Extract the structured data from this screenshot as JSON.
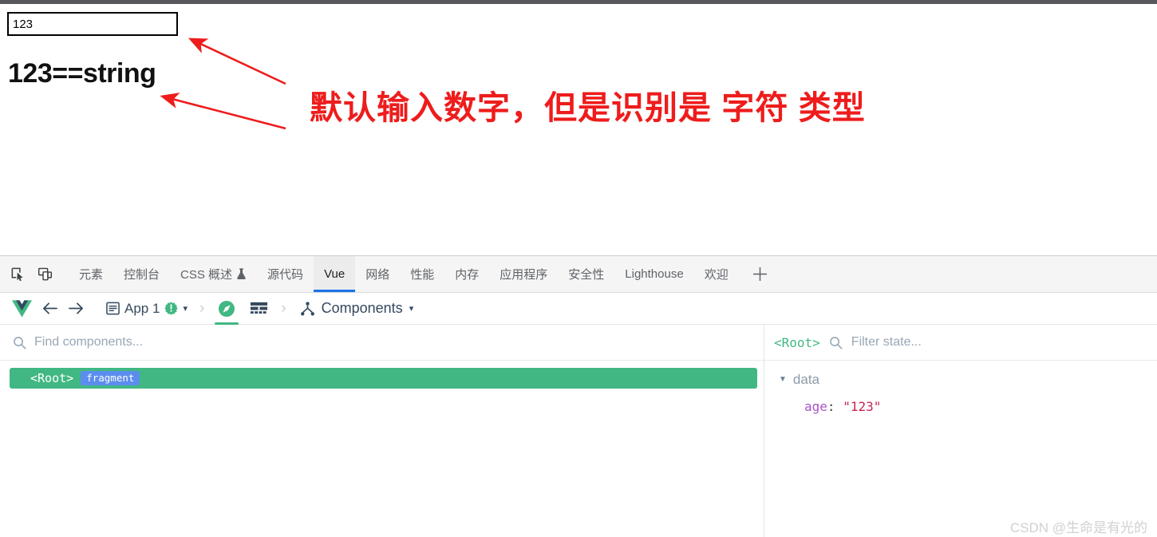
{
  "page": {
    "input": {
      "value": "123",
      "placeholder": ""
    },
    "result_text": "123==string",
    "annotation": "默认输入数字，但是识别是 字符 类型"
  },
  "devtools": {
    "left_icons": [
      {
        "name": "inspect-element-icon"
      },
      {
        "name": "device-toolbar-icon"
      }
    ],
    "tabs": [
      {
        "label": "元素",
        "active": false
      },
      {
        "label": "控制台",
        "active": false
      },
      {
        "label": "CSS 概述",
        "active": false,
        "icon": "flask-icon"
      },
      {
        "label": "源代码",
        "active": false
      },
      {
        "label": "Vue",
        "active": true
      },
      {
        "label": "网络",
        "active": false
      },
      {
        "label": "性能",
        "active": false
      },
      {
        "label": "内存",
        "active": false
      },
      {
        "label": "应用程序",
        "active": false
      },
      {
        "label": "安全性",
        "active": false
      },
      {
        "label": "Lighthouse",
        "active": false
      },
      {
        "label": "欢迎",
        "active": false
      }
    ],
    "add_tab_label": "+",
    "accent_color": "#1a73e8"
  },
  "vue_toolbar": {
    "logo": "vue-logo-icon",
    "back_label": "←",
    "forward_label": "→",
    "app_name": "App 1",
    "app_badge": "!",
    "app_chevron": "▾",
    "breadcrumb_sep": "›",
    "view_tabs": [
      {
        "name": "components-compass-icon",
        "active": true
      },
      {
        "name": "timeline-grid-icon",
        "active": false
      }
    ],
    "current_view": "Components",
    "current_view_chevron": "▾",
    "brand_color": "#42b883"
  },
  "components_pane": {
    "search_placeholder": "Find components...",
    "tree": [
      {
        "tag": "<Root>",
        "badge": "fragment",
        "selected": true
      }
    ]
  },
  "state_pane": {
    "selected_component": "<Root>",
    "filter_placeholder": "Filter state...",
    "groups": [
      {
        "name": "data",
        "expanded": true,
        "triangle": "▼",
        "props": [
          {
            "key": "age",
            "separator": ":",
            "value": "\"123\""
          }
        ]
      }
    ]
  },
  "watermark": "CSDN @生命是有光的"
}
